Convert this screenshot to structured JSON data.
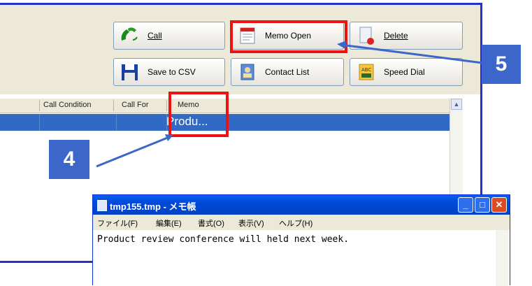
{
  "toolbar": {
    "call_label": "Call",
    "memo_open_label": "Memo Open",
    "delete_label": "Delete",
    "save_csv_label": "Save to CSV",
    "contact_list_label": "Contact List",
    "speed_dial_label": "Speed Dial"
  },
  "table": {
    "columns": [
      "Call Condition",
      "Call For",
      "Memo"
    ],
    "selected_row_memo": "Produ..."
  },
  "callouts": {
    "step4": "4",
    "step5": "5"
  },
  "notepad": {
    "title": "tmp155.tmp - メモ帳",
    "menu": [
      "ファイル(F)",
      "編集(E)",
      "書式(O)",
      "表示(V)",
      "ヘルプ(H)"
    ],
    "content": "Product review conference will held next week.",
    "minimize": "_",
    "maximize": "□",
    "close": "✕"
  },
  "colors": {
    "accent": "#3c66c9",
    "highlight": "#ee1111",
    "selection": "#316ac5"
  },
  "icons": [
    "phone-icon",
    "memo-icon",
    "delete-icon",
    "floppy-disk-icon",
    "contact-book-icon",
    "speed-dial-icon"
  ]
}
